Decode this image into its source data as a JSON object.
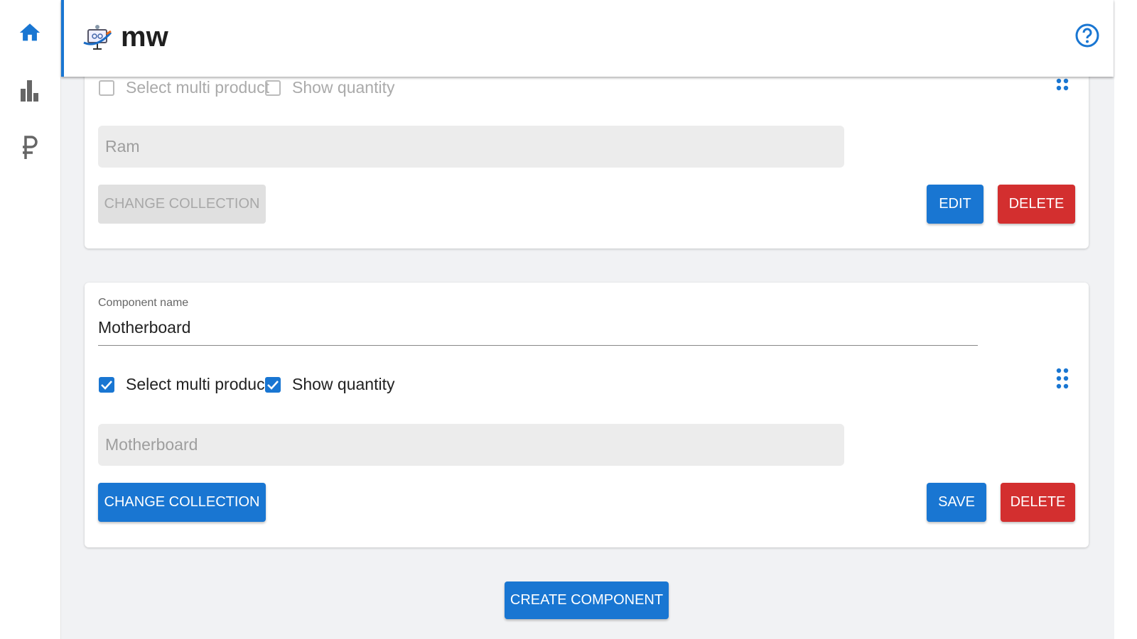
{
  "header": {
    "title": "mw"
  },
  "sidebar": {
    "items": [
      {
        "icon": "home-icon"
      },
      {
        "icon": "bar-chart-icon"
      },
      {
        "icon": "ruble-icon"
      }
    ]
  },
  "colors": {
    "primary": "#1976d2",
    "danger": "#d32f2f"
  },
  "components": [
    {
      "select_multi_label": "Select multi product",
      "select_multi": false,
      "show_quantity_label": "Show quantity",
      "show_quantity": false,
      "collection": "Ram",
      "change_collection": "CHANGE COLLECTION",
      "edit": "EDIT",
      "delete": "DELETE"
    },
    {
      "name_label": "Component name",
      "name": "Motherboard",
      "select_multi_label": "Select multi product",
      "select_multi": true,
      "show_quantity_label": "Show quantity",
      "show_quantity": true,
      "collection": "Motherboard",
      "change_collection": "CHANGE COLLECTION",
      "save": "SAVE",
      "delete": "DELETE"
    }
  ],
  "create_component": "CREATE COMPONENT"
}
